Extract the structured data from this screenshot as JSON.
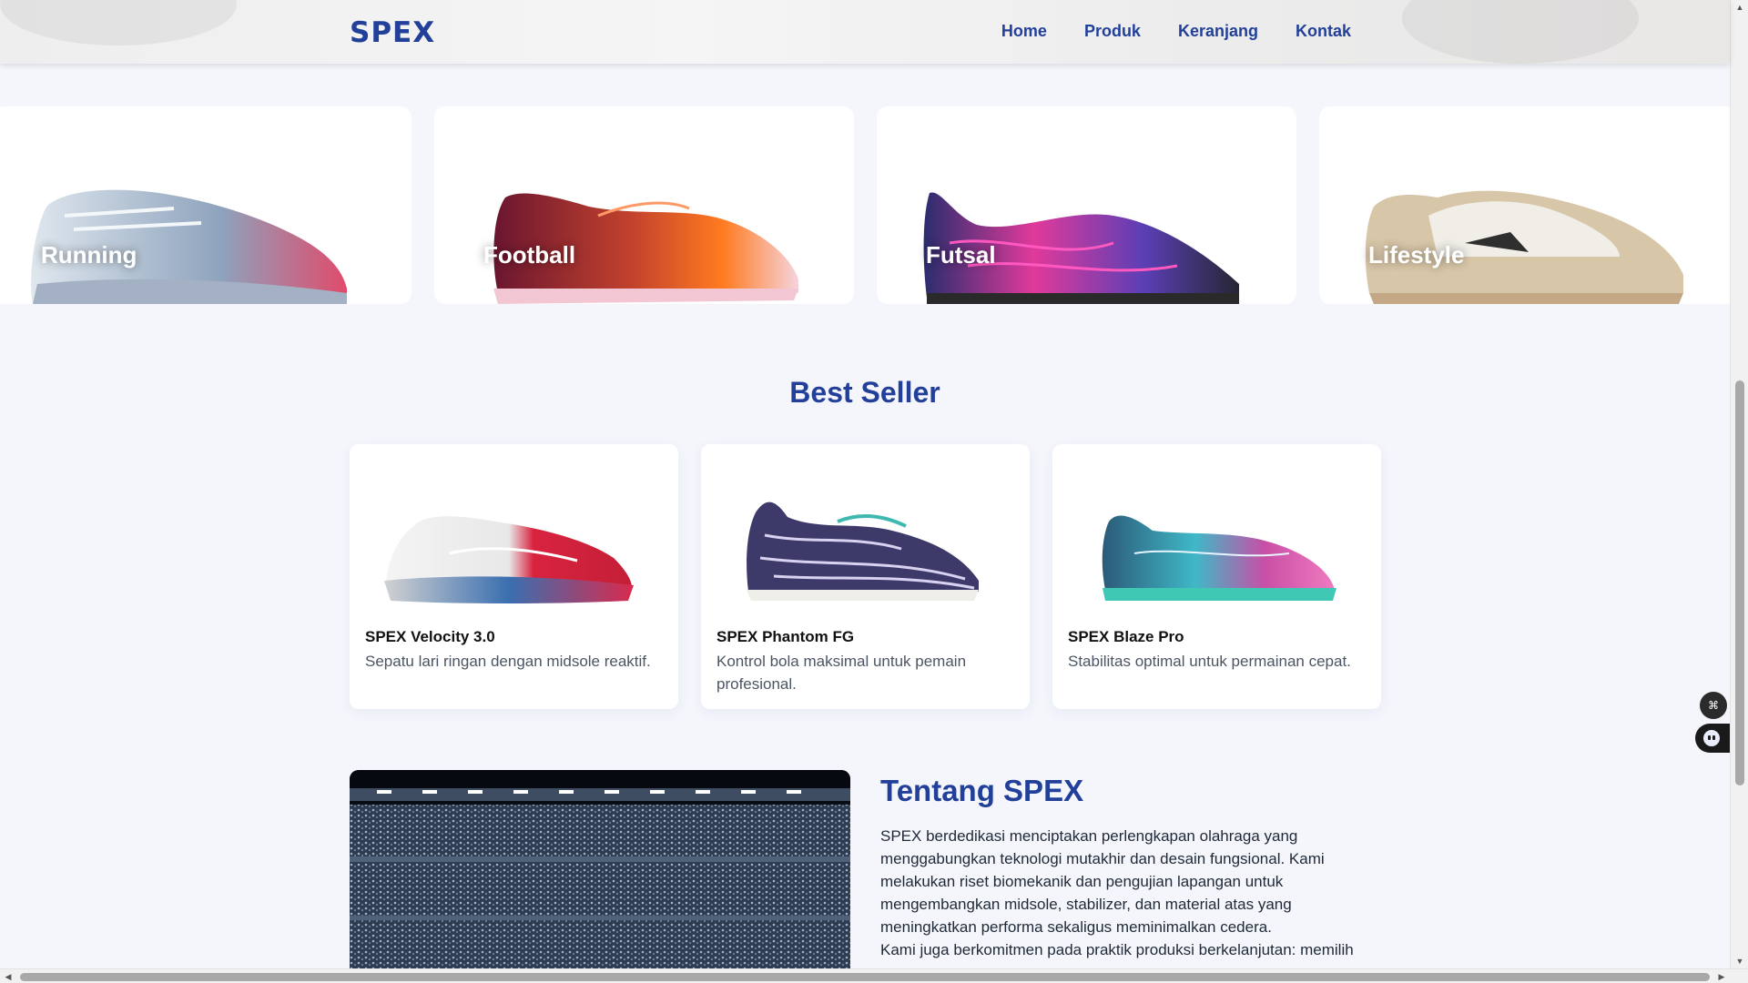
{
  "brand": {
    "logo": "SPEX"
  },
  "nav": {
    "items": [
      "Home",
      "Produk",
      "Keranjang",
      "Kontak"
    ]
  },
  "categories": [
    {
      "label": "Running",
      "icon": "running-shoe-image"
    },
    {
      "label": "Football",
      "icon": "football-boot-image"
    },
    {
      "label": "Futsal",
      "icon": "futsal-shoe-image"
    },
    {
      "label": "Lifestyle",
      "icon": "lifestyle-sneaker-image"
    }
  ],
  "best_seller": {
    "title": "Best Seller",
    "products": [
      {
        "name": "SPEX Velocity 3.0",
        "desc": "Sepatu lari ringan dengan midsole reaktif."
      },
      {
        "name": "SPEX Phantom FG",
        "desc": "Kontrol bola maksimal untuk pemain profesional."
      },
      {
        "name": "SPEX Blaze Pro",
        "desc": "Stabilitas optimal untuk permainan cepat."
      }
    ]
  },
  "about": {
    "title": "Tentang SPEX",
    "paragraph1": "SPEX berdedikasi menciptakan perlengkapan olahraga yang menggabungkan teknologi mutakhir dan desain fungsional. Kami melakukan riset biomekanik dan pengujian lapangan untuk mengembangkan midsole, stabilizer, dan material atas yang meningkatkan performa sekaligus meminimalkan cedera.",
    "paragraph2": "Kami juga berkomitmen pada praktik produksi berkelanjutan: memilih",
    "image": "stadium-photo"
  },
  "colors": {
    "brand": "#22409a",
    "background": "#f4f6fc"
  }
}
